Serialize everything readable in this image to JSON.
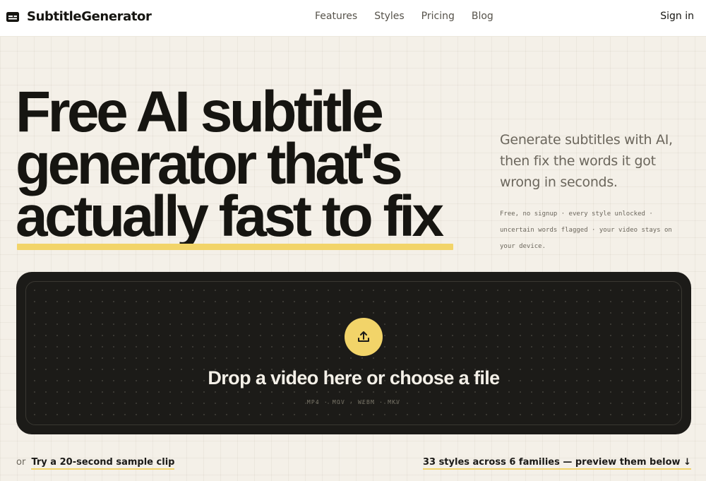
{
  "brand": {
    "name": "SubtitleGenerator",
    "icon": "subtitles-icon"
  },
  "nav": {
    "links": [
      {
        "label": "Features"
      },
      {
        "label": "Styles"
      },
      {
        "label": "Pricing"
      },
      {
        "label": "Blog"
      }
    ],
    "signin": "Sign in"
  },
  "hero": {
    "headline_lines": [
      "Free AI subtitle",
      "generator that's",
      "actually fast to fix"
    ],
    "subhead": "Generate subtitles with AI, then fix the words it got wrong in seconds.",
    "fine_print": "Free, no signup · every style unlocked · uncertain words flagged · your video stays on your device."
  },
  "dropzone": {
    "icon": "upload-icon",
    "title": "Drop a video here or choose a file",
    "formats": "MP4 · MOV · WEBM · MKV"
  },
  "footer_links": {
    "or": "or",
    "sample": "Try a 20-second sample clip",
    "styles": "33 styles across 6 families — preview them below ↓"
  },
  "colors": {
    "accent": "#f2d469",
    "dark": "#1c1b18",
    "background": "#f4f0e8"
  }
}
